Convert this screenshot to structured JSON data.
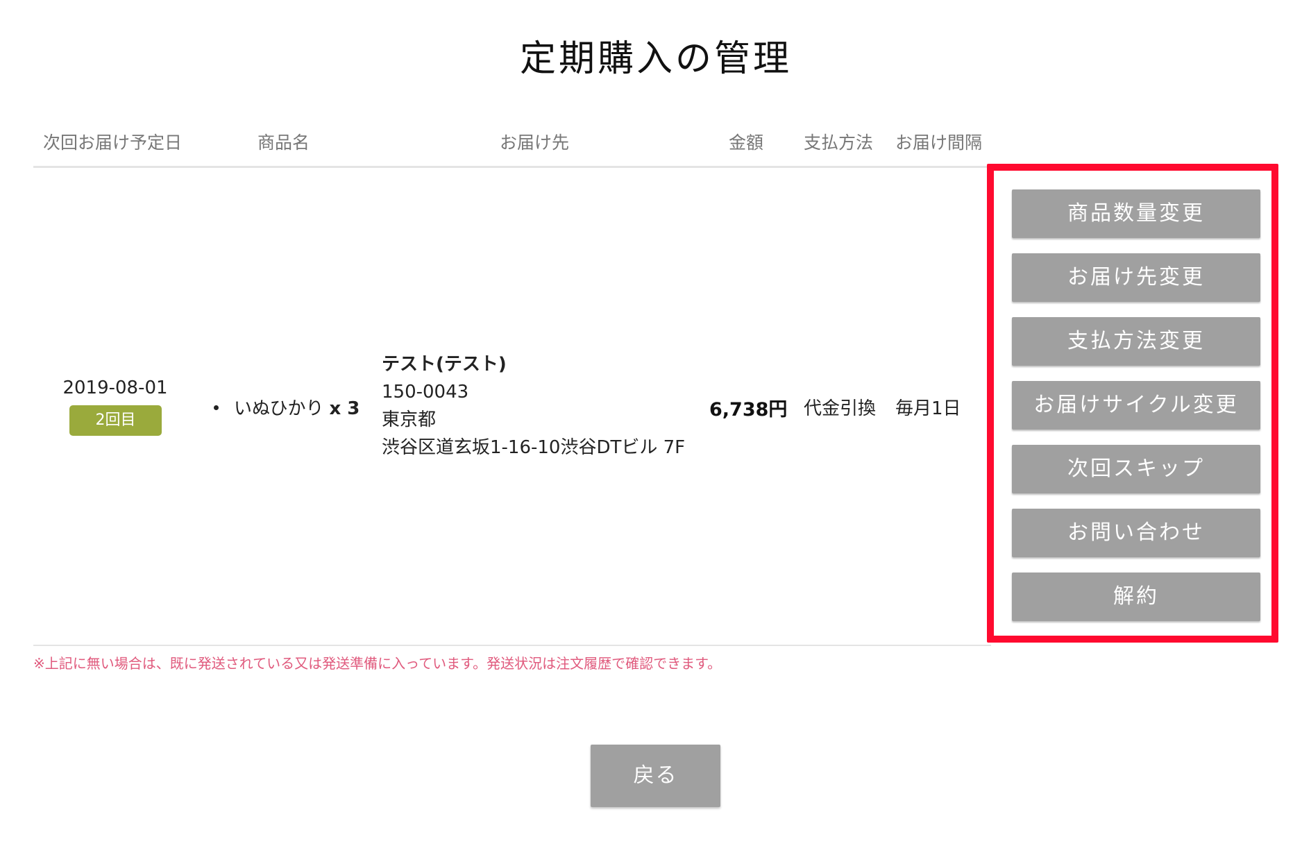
{
  "page": {
    "title": "定期購入の管理"
  },
  "table": {
    "headers": {
      "next_delivery": "次回お届け予定日",
      "product": "商品名",
      "destination": "お届け先",
      "amount": "金額",
      "payment": "支払方法",
      "interval": "お届け間隔"
    },
    "row": {
      "date": "2019-08-01",
      "count_badge": "2回目",
      "product_name": "いぬひかり",
      "product_qty": "x 3",
      "address_name": "テスト(テスト)",
      "postal_code": "150-0043",
      "prefecture": "東京都",
      "street": "渋谷区道玄坂1-16-10渋谷DTビル 7F",
      "amount": "6,738円",
      "payment": "代金引換",
      "interval": "毎月1日"
    }
  },
  "actions": [
    "商品数量変更",
    "お届け先変更",
    "支払方法変更",
    "お届けサイクル変更",
    "次回スキップ",
    "お問い合わせ",
    "解約"
  ],
  "note": "※上記に無い場合は、既に発送されている又は発送準備に入っています。発送状況は注文履歴で確認できます。",
  "back_button": "戻る",
  "colors": {
    "badge": "#9aaa3c",
    "button": "#a0a0a0",
    "highlight": "#ff0a2f",
    "note": "#e05a7d"
  }
}
